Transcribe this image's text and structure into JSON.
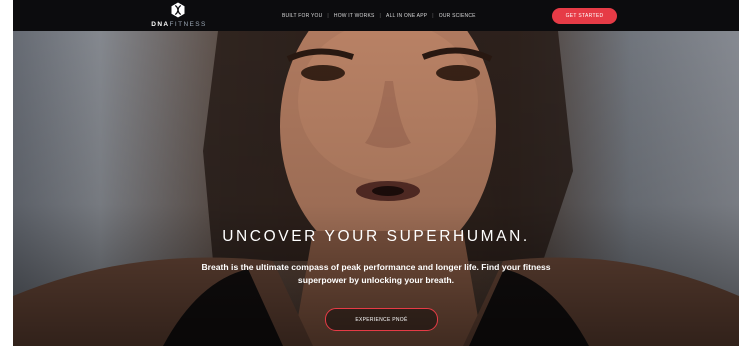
{
  "brand": {
    "logo_bold": "DNA",
    "logo_light": "FITNESS",
    "accent_color": "#e63b46"
  },
  "nav": {
    "links": [
      "BUILT FOR YOU",
      "HOW IT WORKS",
      "ALL IN ONE APP",
      "OUR SCIENCE"
    ],
    "separator": "|",
    "cta_label": "GET STARTED"
  },
  "hero": {
    "headline": "UNCOVER YOUR SUPERHUMAN.",
    "subtext": "Breath is the ultimate compass of peak performance and longer life. Find your fitness superpower by unlocking your breath.",
    "button_label": "EXPERIENCE PNOĒ",
    "image": "athlete-portrait-photo"
  }
}
